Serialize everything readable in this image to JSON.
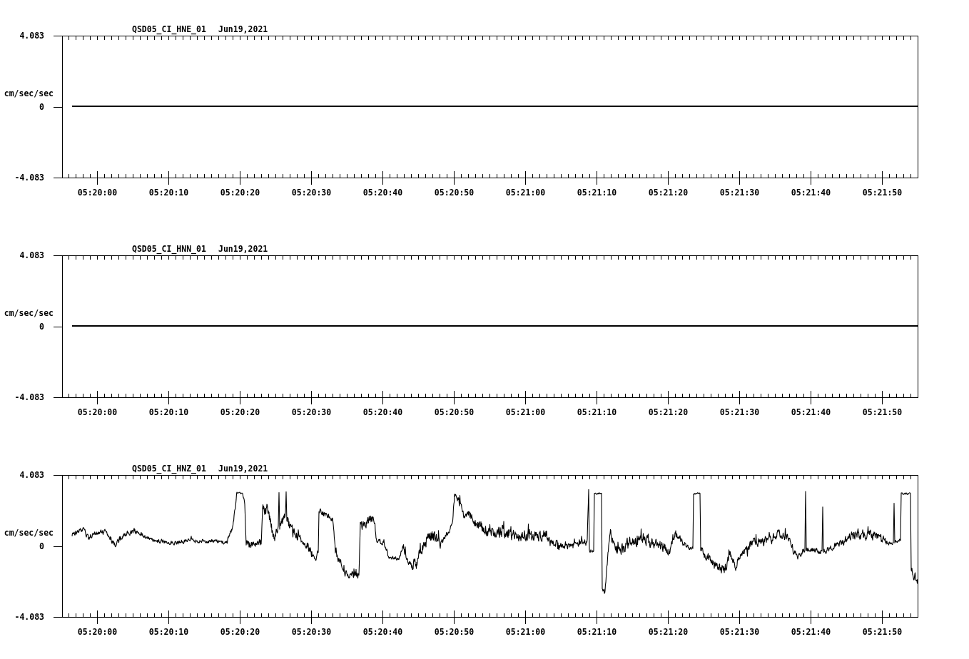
{
  "panels": [
    {
      "station": "QSD05_CI_HNE_01",
      "date": "Jun19,2021",
      "unit": "cm/sec/sec",
      "y_ticks": [
        "4.083",
        "0",
        "-4.083"
      ],
      "x_ticks": [
        "05:20:00",
        "05:20:10",
        "05:20:20",
        "05:20:30",
        "05:20:40",
        "05:20:50",
        "05:21:00",
        "05:21:10",
        "05:21:20",
        "05:21:30",
        "05:21:40",
        "05:21:50"
      ],
      "kind": "flat"
    },
    {
      "station": "QSD05_CI_HNN_01",
      "date": "Jun19,2021",
      "unit": "cm/sec/sec",
      "y_ticks": [
        "4.083",
        "0",
        "-4.083"
      ],
      "x_ticks": [
        "05:20:00",
        "05:20:10",
        "05:20:20",
        "05:20:30",
        "05:20:40",
        "05:20:50",
        "05:21:00",
        "05:21:10",
        "05:21:20",
        "05:21:30",
        "05:21:40",
        "05:21:50"
      ],
      "kind": "flat"
    },
    {
      "station": "QSD05_CI_HNZ_01",
      "date": "Jun19,2021",
      "unit": "cm/sec/sec",
      "y_ticks": [
        "4.083",
        "0",
        "-4.083"
      ],
      "x_ticks": [
        "05:20:00",
        "05:20:10",
        "05:20:20",
        "05:20:30",
        "05:20:40",
        "05:20:50",
        "05:21:00",
        "05:21:10",
        "05:21:20",
        "05:21:30",
        "05:21:40",
        "05:21:50"
      ],
      "kind": "waveform"
    }
  ]
}
